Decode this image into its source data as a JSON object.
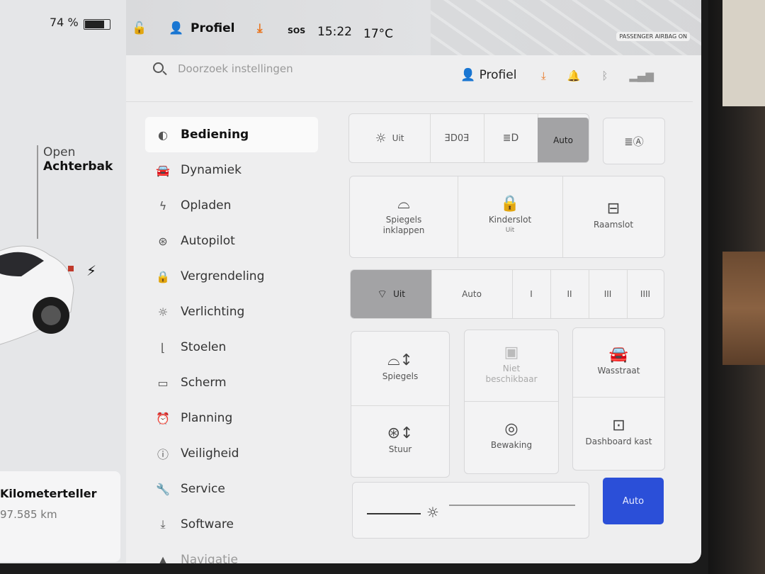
{
  "status": {
    "battery_percent": "74 %",
    "battery_level": 0.74,
    "profile": "Profiel",
    "sos": "SOS",
    "time": "15:22",
    "temperature": "17°C",
    "airbag_label": "PASSENGER AIRBAG ON"
  },
  "car": {
    "trunk_open": "Open",
    "trunk_label": "Achterbak",
    "odometer_label": "Kilometerteller",
    "odometer_value": "97.585 km"
  },
  "header": {
    "search_placeholder": "Doorzoek instellingen",
    "profile": "Profiel"
  },
  "menu": [
    {
      "label": "Bediening",
      "icon": "toggle-icon"
    },
    {
      "label": "Dynamiek",
      "icon": "car-icon"
    },
    {
      "label": "Opladen",
      "icon": "bolt-icon"
    },
    {
      "label": "Autopilot",
      "icon": "steering-wheel-icon"
    },
    {
      "label": "Vergrendeling",
      "icon": "lock-icon"
    },
    {
      "label": "Verlichting",
      "icon": "light-icon"
    },
    {
      "label": "Stoelen",
      "icon": "seat-icon"
    },
    {
      "label": "Scherm",
      "icon": "display-icon"
    },
    {
      "label": "Planning",
      "icon": "alarm-icon"
    },
    {
      "label": "Veiligheid",
      "icon": "warning-icon"
    },
    {
      "label": "Service",
      "icon": "wrench-icon"
    },
    {
      "label": "Software",
      "icon": "download-icon"
    },
    {
      "label": "Navigatie",
      "icon": "navigation-icon"
    }
  ],
  "lights": {
    "off": "Uit",
    "auto": "Auto"
  },
  "tiles1": {
    "mirrors_fold": "Spiegels inklappen",
    "child_lock": "Kinderslot",
    "child_lock_state": "Uit",
    "window_lock": "Raamslot"
  },
  "wipers": {
    "off": "Uit",
    "auto": "Auto",
    "s1": "I",
    "s2": "II",
    "s3": "III",
    "s4": "IIII"
  },
  "tiles2": {
    "mirrors": "Spiegels",
    "unavailable": "Niet beschikbaar",
    "car_wash": "Wasstraat",
    "steering": "Stuur",
    "sentry": "Bewaking",
    "glovebox": "Dashboard kast"
  },
  "brightness": {
    "auto": "Auto",
    "level": 0.2
  }
}
